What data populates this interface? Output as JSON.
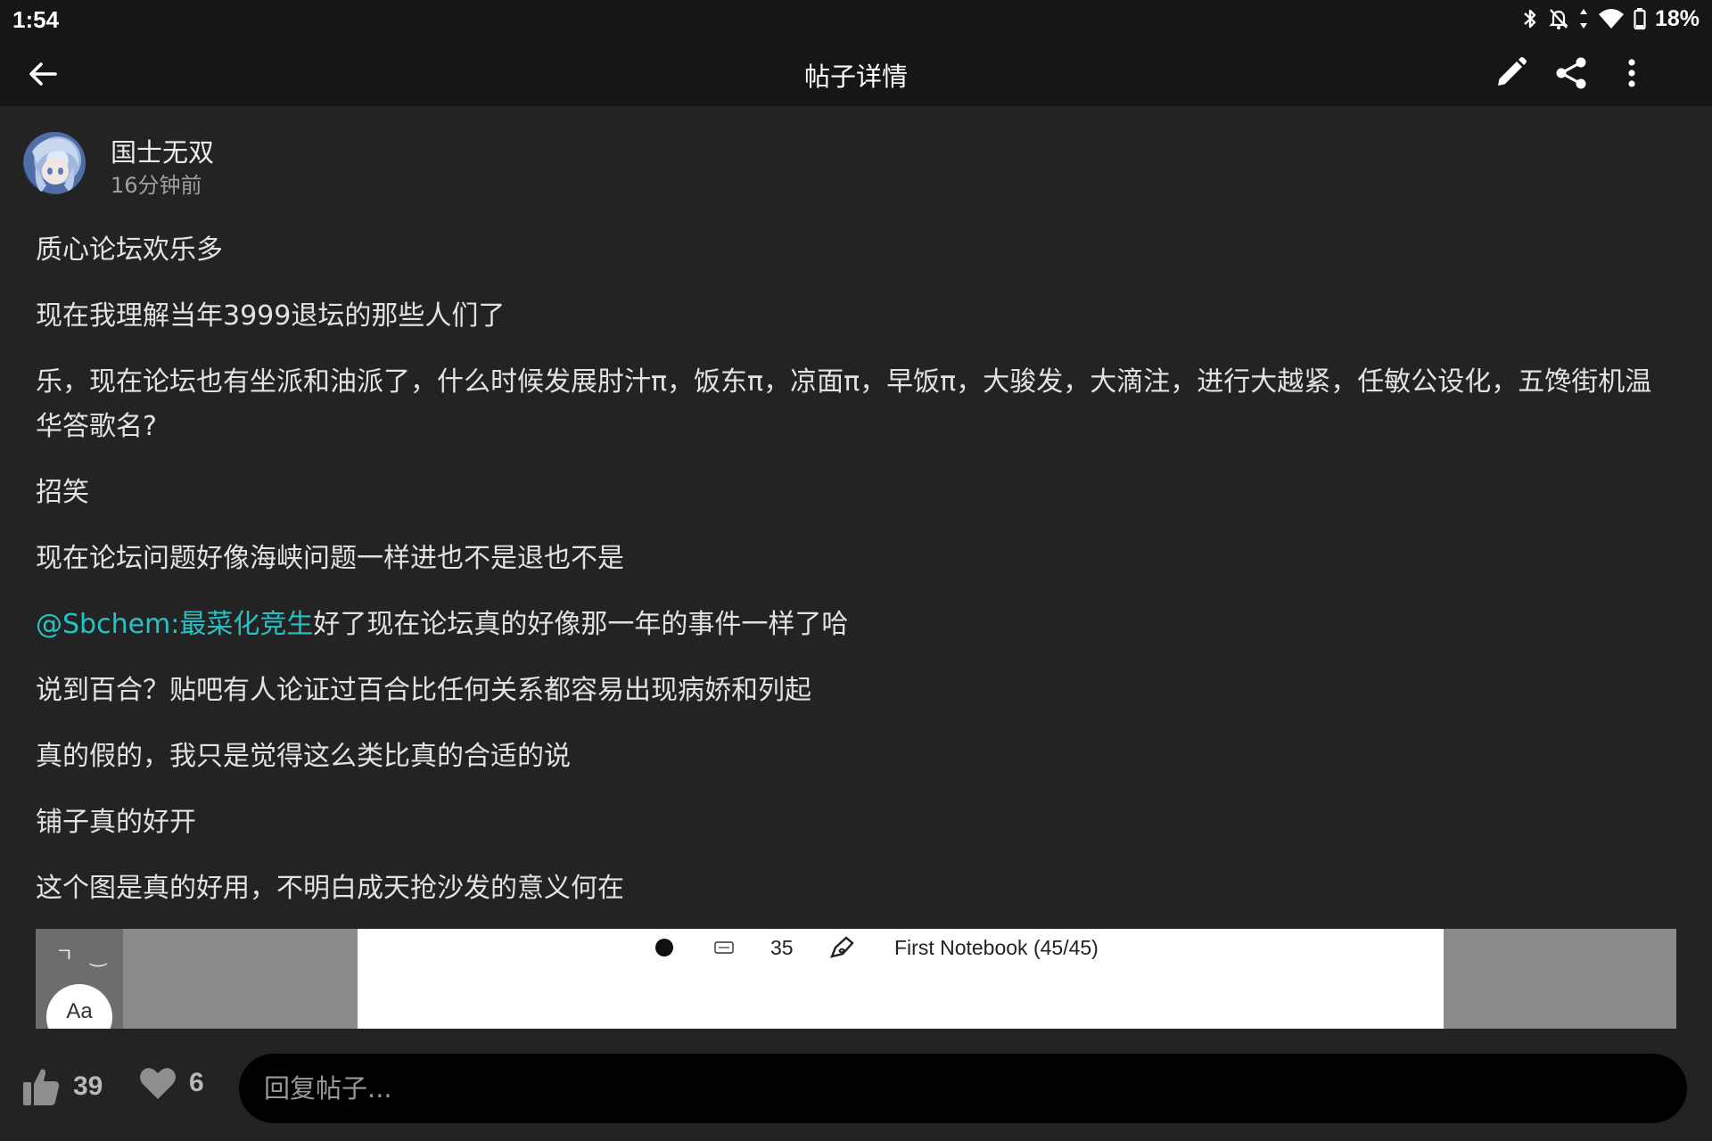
{
  "status_bar": {
    "time": "1:54",
    "battery": "18%",
    "icons": [
      "bluetooth-icon",
      "notifications-off-icon",
      "data-icon",
      "wifi-icon",
      "battery-icon"
    ]
  },
  "app_bar": {
    "title": "帖子详情",
    "icons": [
      "back-arrow-icon",
      "edit-icon",
      "share-icon",
      "more-vert-icon"
    ]
  },
  "author": {
    "name": "国士无双",
    "time": "16分钟前"
  },
  "post": {
    "paragraphs": [
      "质心论坛欢乐多",
      "现在我理解当年3999退坛的那些人们了",
      "乐，现在论坛也有坐派和油派了，什么时候发展肘汁π，饭东π，凉面π，早饭π，大骏发，大滴注，进行大越紧，任敏公设化，五馋街机温华答歌名?",
      "招笑",
      "现在论坛问题好像海峡问题一样进也不是退也不是",
      "说到百合？贴吧有人论证过百合比任何关系都容易出现病娇和列起",
      "真的假的，我只是觉得这么类比真的合适的说",
      "铺子真的好开",
      "这个图是真的好用，不明白成天抢沙发的意义何在"
    ],
    "mention": "@Sbchem:最菜化竞生",
    "mention_suffix": "好了现在论坛真的好像那一年的事件一样了哈"
  },
  "embedded_image": {
    "marks": "ㄱ ‿",
    "aa_label": "Aa",
    "counter": "35",
    "notebook": "First Notebook (45/45)"
  },
  "bottom_bar": {
    "likes": "39",
    "favorites": "6",
    "reply_placeholder": "回复帖子..."
  },
  "colors": {
    "background": "#232323",
    "bar": "#161616",
    "mention": "#26c2c6"
  }
}
